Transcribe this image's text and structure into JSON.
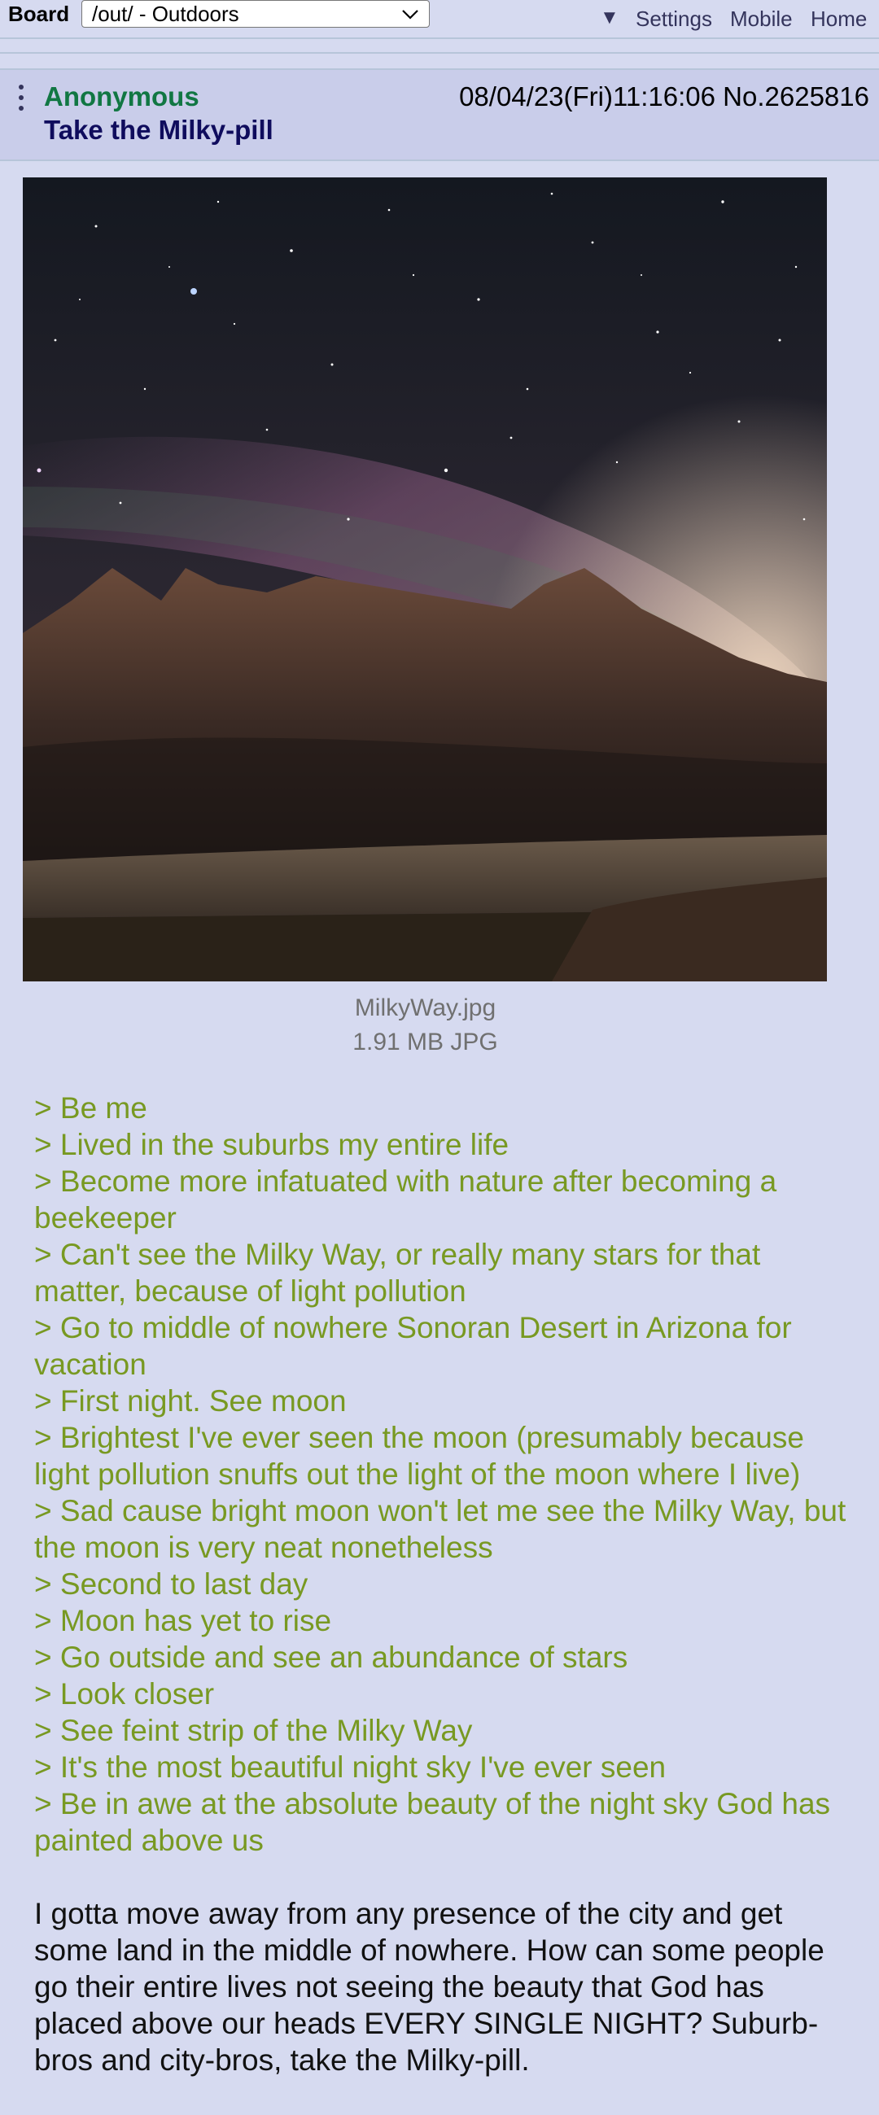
{
  "topbar": {
    "board_label": "Board",
    "board_select_value": "/out/ - Outdoors",
    "nav_arrow": "▼",
    "nav_settings": "Settings",
    "nav_mobile": "Mobile",
    "nav_home": "Home"
  },
  "post": {
    "name": "Anonymous",
    "datetime_and_number": "08/04/23(Fri)11:16:06 No.2625816",
    "subject": "Take the Milky-pill",
    "file": {
      "name": "MilkyWay.jpg",
      "size": "1.91 MB JPG"
    },
    "greentext": [
      "> Be me",
      "> Lived in the suburbs my entire life",
      "> Become more infatuated with nature after becoming a beekeeper",
      "> Can't see the Milky Way, or really many stars for that matter, because of light pollution",
      "> Go to middle of nowhere Sonoran Desert in Arizona for vacation",
      "> First night. See moon",
      "> Brightest I've ever seen the moon (presumably because light pollution snuffs out the light of the moon where I live)",
      "> Sad cause bright moon won't let me see the Milky Way, but the moon is very neat nonetheless",
      "> Second to last day",
      "> Moon has yet to rise",
      "> Go outside and see an abundance of stars",
      "> Look closer",
      "> See feint strip of the Milky Way",
      "> It's the most beautiful night sky I've ever seen",
      "> Be in awe at the absolute beauty of the night sky God has painted above us"
    ],
    "paragraph": "I gotta move away from any presence of the city and get some land in the middle of nowhere. How can some people go their entire lives not seeing the beauty that God has placed above our heads EVERY SINGLE NIGHT? Suburb-bros and city-bros, take the Milky-pill."
  },
  "colors": {
    "background": "#d6daf0",
    "header_bg": "#c9cdea",
    "name_green": "#117743",
    "subject_blue": "#0f0c5d",
    "greentext": "#789922",
    "link": "#34345c"
  }
}
